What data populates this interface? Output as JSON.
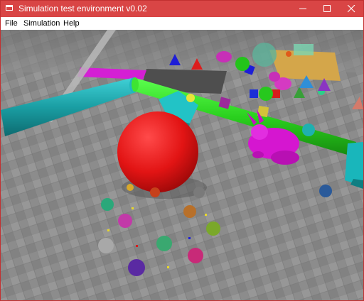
{
  "window": {
    "title": "Simulation test environment v0.02",
    "accent_color": "#d94545",
    "controls": [
      "minimize-icon",
      "maximize-icon",
      "close-icon"
    ]
  },
  "menubar": {
    "items": [
      {
        "label": "File"
      },
      {
        "label": "Simulation"
      },
      {
        "label": "Help"
      }
    ]
  },
  "scene": {
    "floor_color": "#8a8a8a",
    "objects": [
      "red-sphere",
      "green-cylinder",
      "cyan-cylinder",
      "magenta-bunny",
      "cyan-cube",
      "yellow-plate",
      "colored-spheres",
      "colored-cones",
      "small-cubes"
    ]
  }
}
